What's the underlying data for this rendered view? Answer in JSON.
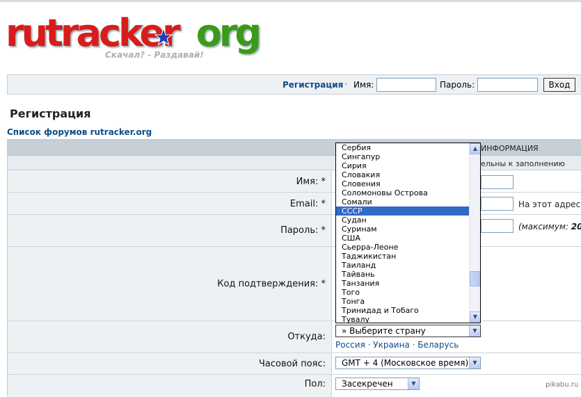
{
  "logo": {
    "part1": "rutracker",
    "part2": "org",
    "tagline": "Скачал? - Раздавай!",
    "colors": {
      "red": "#d81c1c",
      "green": "#3a9a1a",
      "star": "#1f3fb8"
    }
  },
  "loginbar": {
    "register_link": "Регистрация",
    "separator": "·",
    "name_label": "Имя:",
    "password_label": "Пароль:",
    "login_button": "Вход"
  },
  "page": {
    "title": "Регистрация",
    "forum_link": "Список форумов rutracker.org"
  },
  "form": {
    "header_text": "ИНФОРМАЦИЯ",
    "subheader_text": "ельны к заполнению",
    "fields": {
      "name_label": "Имя: *",
      "email_label": "Email: *",
      "email_note": "На этот адрес в",
      "password_label": "Пароль: *",
      "password_note_prefix": "(максимум: ",
      "password_note_value": "20",
      "captcha_label": "Код подтверждения: *",
      "from_label": "Откуда:",
      "country_select_value": "» Выберите страну",
      "timezone_label": "Часовой пояс:",
      "timezone_value": "GMT + 4 (Московское время)",
      "gender_label": "Пол:",
      "gender_value": "Засекречен"
    },
    "country_links": [
      "Россия",
      "Украина",
      "Беларусь"
    ],
    "country_dropdown": {
      "options": [
        "Сербия",
        "Сингапур",
        "Сирия",
        "Словакия",
        "Словения",
        "Соломоновы Острова",
        "Сомали",
        "СССР",
        "Судан",
        "Суринам",
        "США",
        "Сьерра-Леоне",
        "Таджикистан",
        "Таиланд",
        "Тайвань",
        "Танзания",
        "Того",
        "Тонга",
        "Тринидад и Тобаго",
        "Тувалу"
      ],
      "selected": "СССР",
      "selected_color": "#316ac5"
    }
  },
  "watermark": "pikabu.ru"
}
